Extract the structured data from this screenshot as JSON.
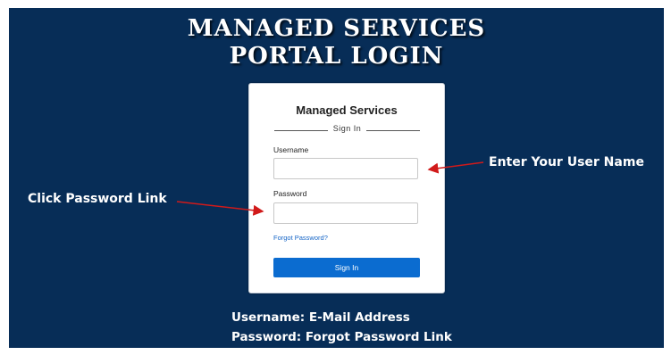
{
  "slide": {
    "title_line1": "MANAGED SERVICES",
    "title_line2": "PORTAL LOGIN"
  },
  "login": {
    "heading": "Managed Services",
    "sign_in_caption": "Sign In",
    "username_label": "Username",
    "username_value": "",
    "password_label": "Password",
    "password_value": "",
    "forgot_link": "Forgot Password?",
    "sign_in_button": "Sign In"
  },
  "annotations": {
    "username_hint": "Enter Your User Name",
    "password_hint": "Click Password Link",
    "note_username": "Username: E-Mail Address",
    "note_password": "Password: Forgot Password Link"
  },
  "colors": {
    "background": "#072d57",
    "button": "#0b6cd0",
    "link": "#1766c7",
    "arrow": "#d11a1a"
  }
}
